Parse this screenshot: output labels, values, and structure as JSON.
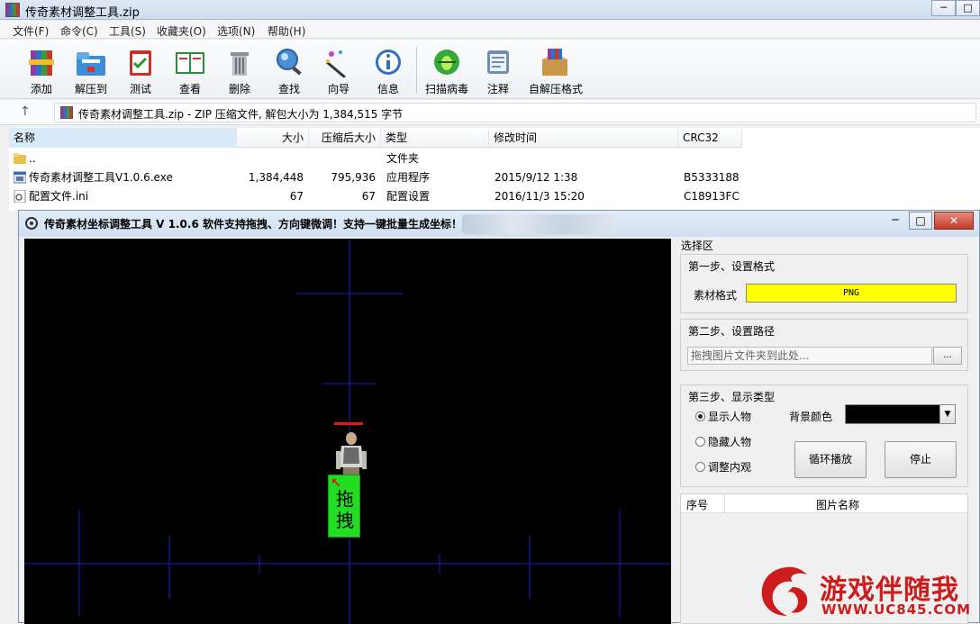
{
  "winrar": {
    "title": "传奇素材调整工具.zip",
    "menu": [
      "文件(F)",
      "命令(C)",
      "工具(S)",
      "收藏夹(O)",
      "选项(N)",
      "帮助(H)"
    ],
    "toolbar": [
      "添加",
      "解压到",
      "测试",
      "查看",
      "删除",
      "查找",
      "向导",
      "信息",
      "扫描病毒",
      "注释",
      "自解压格式"
    ],
    "address": "传奇素材调整工具.zip - ZIP 压缩文件, 解包大小为 1,384,515 字节",
    "columns": [
      "名称",
      "大小",
      "压缩后大小",
      "类型",
      "修改时间",
      "CRC32"
    ],
    "rows": [
      {
        "name": "..",
        "size": "",
        "packed": "",
        "type": "文件夹",
        "modified": "",
        "crc": ""
      },
      {
        "name": "传奇素材调整工具V1.0.6.exe",
        "size": "1,384,448",
        "packed": "795,936",
        "type": "应用程序",
        "modified": "2015/9/12 1:38",
        "crc": "B5333188"
      },
      {
        "name": "配置文件.ini",
        "size": "67",
        "packed": "67",
        "type": "配置设置",
        "modified": "2016/11/3 15:20",
        "crc": "C18913FC"
      }
    ]
  },
  "tool": {
    "title": "传奇素材坐标调整工具 V 1.0.6  软件支持拖拽、方向键微调！支持一键批量生成坐标！",
    "drag_label": "拖拽",
    "panel_title": "选择区",
    "step1": {
      "title": "第一步、设置格式",
      "label": "素材格式",
      "value": "PNG",
      "color": "#ffff00"
    },
    "step2": {
      "title": "第二步、设置路径",
      "placeholder": "拖拽图片文件夹到此处...",
      "browse": "..."
    },
    "step3": {
      "title": "第三步、显示类型",
      "options": [
        "显示人物",
        "隐藏人物",
        "调整内观"
      ],
      "selected": 0,
      "bg_label": "背景颜色",
      "bg_color": "#000000",
      "loop_button": "循环播放",
      "stop_button": "停止"
    },
    "list_columns": [
      "序号",
      "图片名称"
    ]
  },
  "watermark": {
    "text": "游戏伴随我",
    "url": "WWW.UC845.COM"
  }
}
